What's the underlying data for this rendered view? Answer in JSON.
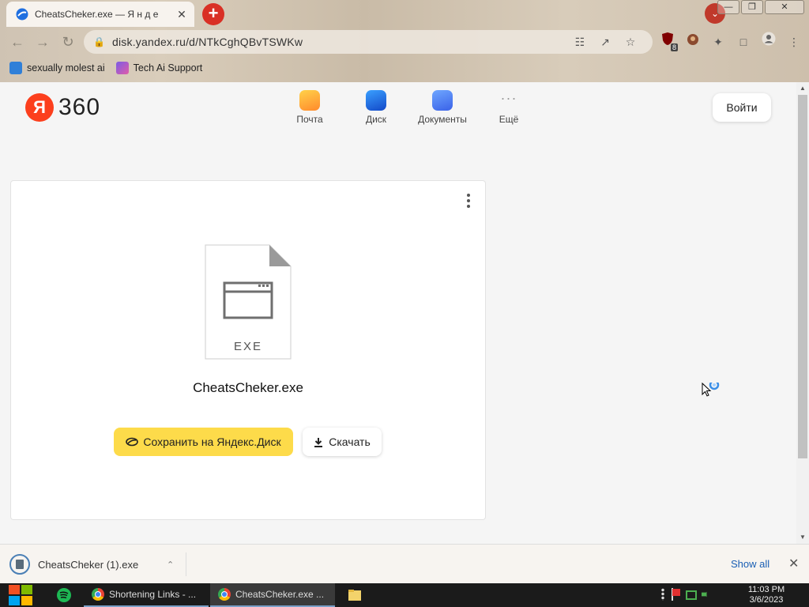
{
  "browser": {
    "tab": {
      "title": "CheatsCheker.exe — Я н д е",
      "close": "✕"
    },
    "new_tab": "+",
    "tab_search": "⌄",
    "window_buttons": {
      "minimize": "—",
      "restore": "❐",
      "close": "✕"
    },
    "nav": {
      "back": "←",
      "forward": "→",
      "reload": "↻"
    },
    "url": "disk.yandex.ru/d/NTkCghQBvTSWKw",
    "extension_badge": "8",
    "bookmarks": [
      {
        "label": "sexually molest ai",
        "color": "#2f7fd8"
      },
      {
        "label": "Tech Ai Support",
        "color": "#7b5ce6"
      }
    ]
  },
  "header": {
    "logo_letter": "Я",
    "logo_text": "360",
    "services": [
      {
        "label": "Почта",
        "icon": "mail-icon",
        "color": "#ffb02e"
      },
      {
        "label": "Диск",
        "icon": "disk-icon",
        "color": "#1f6fe0"
      },
      {
        "label": "Документы",
        "icon": "docs-icon",
        "color": "#4c7dfb"
      },
      {
        "label": "Ещё",
        "icon": "more-icon",
        "color": "#999999"
      }
    ],
    "login_label": "Войти"
  },
  "file": {
    "extension": "EXE",
    "name": "CheatsCheker.exe",
    "save_label": "Сохранить на Яндекс.Диск",
    "download_label": "Скачать"
  },
  "download_shelf": {
    "item_name": "CheatsCheker (1).exe",
    "show_all": "Show all",
    "close": "✕"
  },
  "taskbar": {
    "apps": [
      {
        "label": "Shortening Links - ..."
      },
      {
        "label": "CheatsCheker.exe ..."
      }
    ],
    "time": "11:03 PM",
    "date": "3/6/2023"
  }
}
